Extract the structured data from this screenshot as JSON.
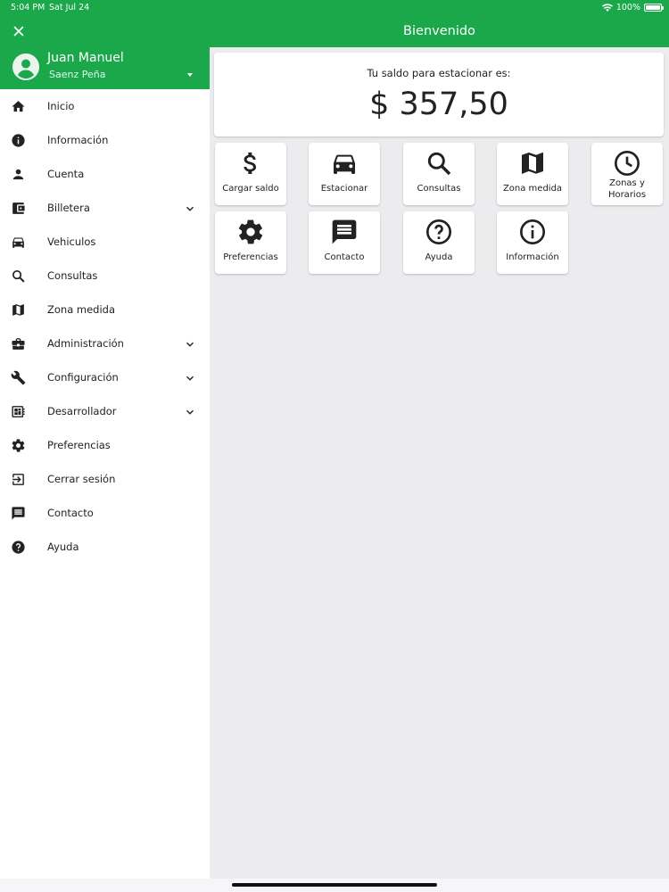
{
  "status": {
    "time": "5:04 PM",
    "date": "Sat Jul 24",
    "battery": "100%"
  },
  "app": {
    "title": "Bienvenido"
  },
  "user": {
    "name": "Juan Manuel",
    "subtitle": "Saenz Peña"
  },
  "menu": [
    {
      "label": "Inicio",
      "icon": "home-icon",
      "expandable": false
    },
    {
      "label": "Información",
      "icon": "info-icon",
      "expandable": false
    },
    {
      "label": "Cuenta",
      "icon": "person-icon",
      "expandable": false
    },
    {
      "label": "Billetera",
      "icon": "wallet-icon",
      "expandable": true
    },
    {
      "label": "Vehiculos",
      "icon": "car-icon",
      "expandable": false
    },
    {
      "label": "Consultas",
      "icon": "search-icon",
      "expandable": false
    },
    {
      "label": "Zona medida",
      "icon": "map-icon",
      "expandable": false
    },
    {
      "label": "Administración",
      "icon": "briefcase-icon",
      "expandable": true
    },
    {
      "label": "Configuración",
      "icon": "wrench-icon",
      "expandable": true
    },
    {
      "label": "Desarrollador",
      "icon": "developer-board-icon",
      "expandable": true
    },
    {
      "label": "Preferencias",
      "icon": "gear-icon",
      "expandable": false
    },
    {
      "label": "Cerrar sesión",
      "icon": "logout-icon",
      "expandable": false
    },
    {
      "label": "Contacto",
      "icon": "message-icon",
      "expandable": false
    },
    {
      "label": "Ayuda",
      "icon": "help-icon",
      "expandable": false
    }
  ],
  "balance": {
    "label": "Tu saldo para estacionar es:",
    "value": "$ 357,50"
  },
  "tiles": [
    {
      "label": "Cargar saldo",
      "icon": "dollar-icon"
    },
    {
      "label": "Estacionar",
      "icon": "car-icon"
    },
    {
      "label": "Consultas",
      "icon": "search-icon"
    },
    {
      "label": "Zona medida",
      "icon": "map-icon"
    },
    {
      "label": "Zonas y Horarios",
      "label_line1": "Zonas y",
      "label_line2": "Horarios",
      "icon": "clock-icon"
    },
    {
      "label": "Preferencias",
      "icon": "gear-icon"
    },
    {
      "label": "Contacto",
      "icon": "message-icon"
    },
    {
      "label": "Ayuda",
      "icon": "help-icon"
    },
    {
      "label": "Información",
      "icon": "info-icon"
    }
  ],
  "colors": {
    "brand": "#1aa84b",
    "background": "#ececef",
    "text": "#222222"
  }
}
